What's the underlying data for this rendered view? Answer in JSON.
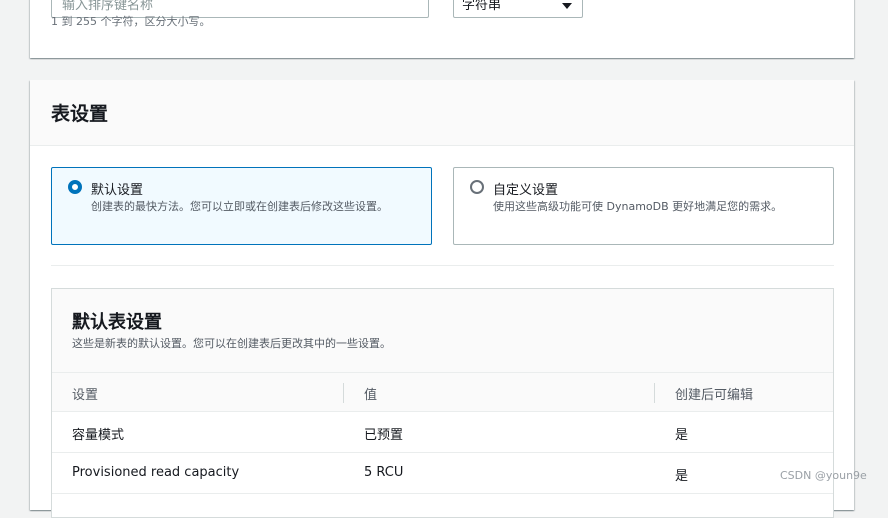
{
  "key_name": {
    "placeholder": "输入排序键名称",
    "hint": "1 到 255 个字符，区分大小写。",
    "type_select": "字符串"
  },
  "table_settings": {
    "title": "表设置",
    "options": [
      {
        "title": "默认设置",
        "description": "创建表的最快方法。您可以立即或在创建表后修改这些设置。",
        "selected": true
      },
      {
        "title": "自定义设置",
        "description": "使用这些高级功能可使 DynamoDB 更好地满足您的需求。",
        "selected": false
      }
    ]
  },
  "default_settings": {
    "title": "默认表设置",
    "description": "这些是新表的默认设置。您可以在创建表后更改其中的一些设置。",
    "columns": [
      "设置",
      "值",
      "创建后可编辑"
    ],
    "rows": [
      {
        "setting": "容量模式",
        "value": "已预置",
        "editable": "是"
      },
      {
        "setting": "Provisioned read capacity",
        "value": "5 RCU",
        "editable": "是"
      }
    ]
  },
  "watermark": "CSDN @youn9e",
  "colors": {
    "accent": "#0073bb",
    "page_bg": "#f2f3f3"
  }
}
